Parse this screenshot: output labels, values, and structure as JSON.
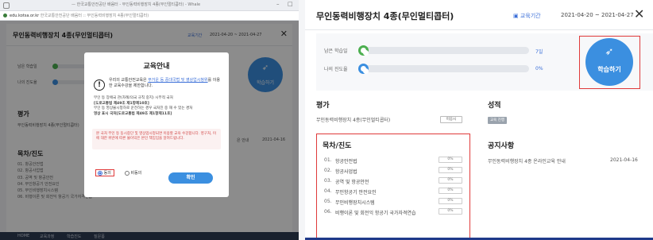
{
  "left": {
    "window": {
      "title": "— 한국교통안전공단 배움터 - 무인동력비행장치 4종(무인멀티콥터) - Whale",
      "url_domain": "edu.kotsa.or.kr",
      "url_rest": "한국교통안전공단 배움터 :: 무인동력비행장치 4종(무인멀티콥터)"
    },
    "header": {
      "title": "무인동력비행장치 4종(무인멀티콥터)",
      "period_label": "교육기간",
      "dates": "2021-04-20 ~ 2021-04-27"
    },
    "progress": {
      "study_label": "남은 학습일",
      "progress_label": "나의 진도율"
    },
    "study_button": "학습하기",
    "eval": {
      "heading": "평가",
      "course": "무인동력비행장치 4종(무인멀티콥터)"
    },
    "toc": {
      "heading": "목차/진도",
      "items": [
        "01. 항공안전법",
        "02. 항공사업법",
        "03. 공역 및 항공안전",
        "04. 무인항공기 안전요인",
        "05. 무인비행장치시스템",
        "06. 비행이론 및 회전익 항공기 국가자격연습"
      ]
    },
    "side_fragments": {
      "frag1": "은 안내",
      "frag2": "2021-04-16"
    },
    "footer": {
      "home": "HOME",
      "learn": "교육과정",
      "my": "학습진도",
      "qna": "질문폼",
      "user": "지원목록"
    },
    "modal": {
      "title": "교육안내",
      "info_icon": "!",
      "intro_before": "우리의 교통안전교육은 ",
      "intro_link1": "무거운 등 중대국법 및 영상업시청위",
      "intro_after": "를 이용한 교육수강을 제한합니다.",
      "rule1": "무인 등 장애국 관(차례/의국 규칙 중지) 시부적 국처",
      "rule1_ref": "[도로교통법 제49조 제1항제10호]",
      "rule2": "무인 등 영상물시청하로 운전하는 경우 국처진 중 해 수 있는 경처",
      "rule2_ref": "영상 표시 국처[도로교통법 제49조 제1항제11호]",
      "warning": "본 국처 무인 등 동시중단 및 영상업시청되면 이용할 교육 수강합니다. 영구처, 이에 대한 위반에 따른 불이익은 본인 책임임을 알려드립니다.",
      "agree": "동의",
      "disagree": "비동의",
      "confirm": "확인"
    }
  },
  "right": {
    "header": {
      "title": "무인동력비행장치 4종(무인멀티콥터)",
      "period_label": "교육기간",
      "dates": "2021-04-20 ~ 2021-04-27"
    },
    "progress": {
      "study_label": "남은 학습일",
      "study_value": "7일",
      "progress_label": "나의 진도율",
      "progress_value": "0%"
    },
    "study_button": "학습하기",
    "eval": {
      "heading": "평가",
      "course": "무인동력비행장치 4종(무인멀티콥터)",
      "status": "미응시"
    },
    "grade": {
      "heading": "성적",
      "badge": "교육 진행"
    },
    "notice": {
      "heading": "공지사항",
      "item": "무인동력비행장치 4종 온라인교육 안내",
      "date": "2021-04-16"
    },
    "toc": {
      "heading": "목차/진도",
      "items": [
        {
          "num": "01.",
          "label": "항공안전법",
          "pct": "0%"
        },
        {
          "num": "02.",
          "label": "항공사업법",
          "pct": "0%"
        },
        {
          "num": "03.",
          "label": "공역 및 항공안전",
          "pct": "0%"
        },
        {
          "num": "04.",
          "label": "무인항공기 안전요인",
          "pct": "0%"
        },
        {
          "num": "05.",
          "label": "무인비행장치시스템",
          "pct": "0%"
        },
        {
          "num": "06.",
          "label": "비행이론 및 회전익 항공기 국가자격연습",
          "pct": "0%"
        }
      ]
    }
  },
  "colors": {
    "accent": "#3b8fe0",
    "highlight": "#e03a3a",
    "study_dot": "#4caf50",
    "progress_dot": "#3b8fe0"
  }
}
